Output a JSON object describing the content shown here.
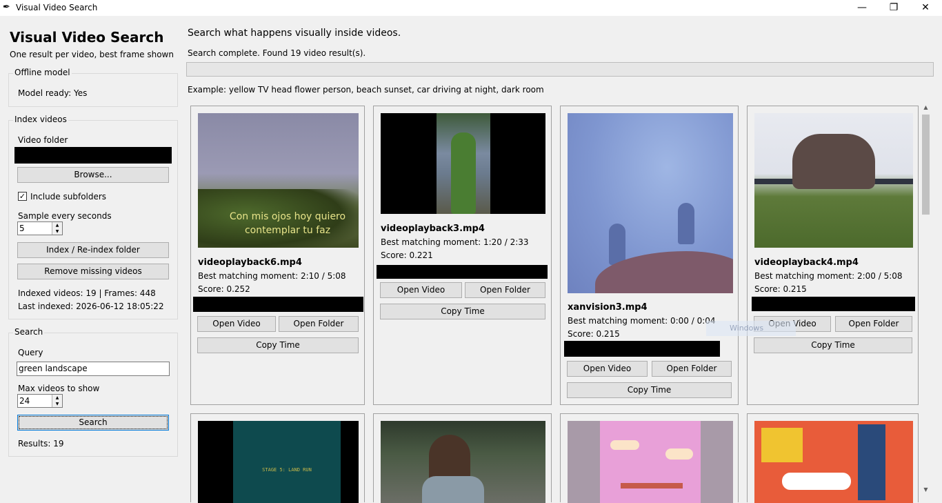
{
  "window": {
    "title": "Visual Video Search",
    "minimize_glyph": "—",
    "maximize_glyph": "❐",
    "close_glyph": "✕"
  },
  "sidebar": {
    "app_title": "Visual Video Search",
    "app_subtitle": "One result per video, best frame shown",
    "offline_model": {
      "legend": "Offline model",
      "status": "Model ready: Yes"
    },
    "index": {
      "legend": "Index videos",
      "folder_label": "Video folder",
      "browse_label": "Browse...",
      "include_subfolders_label": "Include subfolders",
      "include_subfolders_checked": true,
      "sample_label": "Sample every seconds",
      "sample_value": "5",
      "reindex_label": "Index / Re-index folder",
      "remove_missing_label": "Remove missing videos",
      "indexed_stats": "Indexed videos: 19 | Frames: 448",
      "last_indexed": "Last indexed: 2026-06-12 18:05:22"
    },
    "search": {
      "legend": "Search",
      "query_label": "Query",
      "query_value": "green landscape",
      "max_label": "Max videos to show",
      "max_value": "24",
      "search_button": "Search",
      "results": "Results: 19"
    }
  },
  "main": {
    "headline": "Search what happens visually inside videos.",
    "status": "Search complete. Found 19 video result(s).",
    "example": "Example: yellow TV head flower person, beach sunset, car driving at night, dark room",
    "open_video_label": "Open Video",
    "open_folder_label": "Open Folder",
    "copy_time_label": "Copy Time",
    "results": [
      {
        "file": "videoplayback6.mp4",
        "moment": "Best matching moment: 2:10 / 5:08",
        "score": "Score: 0.252",
        "overlay": "Con mis ojos hoy quiero contemplar tu faz"
      },
      {
        "file": "videoplayback3.mp4",
        "moment": "Best matching moment: 1:20 / 2:33",
        "score": "Score: 0.221"
      },
      {
        "file": "xanvision3.mp4",
        "moment": "Best matching moment: 0:00 / 0:04",
        "score": "Score: 0.215"
      },
      {
        "file": "videoplayback4.mp4",
        "moment": "Best matching moment: 2:00 / 5:08",
        "score": "Score: 0.215"
      }
    ],
    "row2_overlay": "STAGE 5: LAND RUN"
  },
  "watermark": "Windows"
}
